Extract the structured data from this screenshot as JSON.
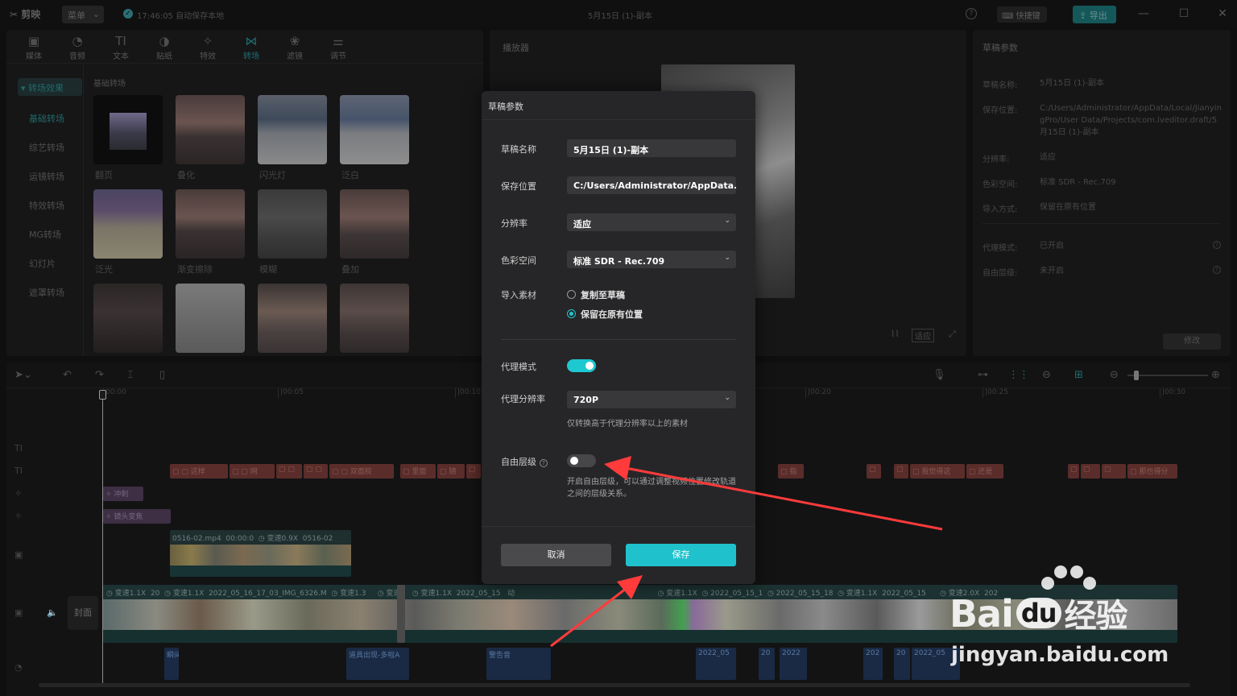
{
  "app": {
    "logo": "剪映",
    "menu_label": "菜单",
    "autosave_text": "17:46:05 自动保存本地",
    "project_title": "5月15日 (1)-副本",
    "shortcut_label": "快捷键",
    "export_label": "导出",
    "accent": "#1ec8d0"
  },
  "media_panel": {
    "tabs": [
      {
        "label": "媒体",
        "icon": "media-icon"
      },
      {
        "label": "音频",
        "icon": "audio-icon"
      },
      {
        "label": "文本",
        "icon": "text-icon"
      },
      {
        "label": "贴纸",
        "icon": "sticker-icon"
      },
      {
        "label": "特效",
        "icon": "effects-icon"
      },
      {
        "label": "转场",
        "icon": "transition-icon"
      },
      {
        "label": "滤镜",
        "icon": "filter-icon"
      },
      {
        "label": "调节",
        "icon": "adjust-icon"
      }
    ],
    "active_tab": "转场",
    "categories": [
      "转场效果",
      "基础转场",
      "综艺转场",
      "运镜转场",
      "特效转场",
      "MG转场",
      "幻灯片",
      "遮罩转场"
    ],
    "section_title": "基础转场",
    "thumbnails": [
      "翻页",
      "叠化",
      "闪光灯",
      "泛白",
      "泛光",
      "渐变擦除",
      "模糊",
      "叠加",
      "",
      "",
      "",
      ""
    ]
  },
  "player": {
    "title": "播放器",
    "ratio_label": "适应"
  },
  "draft_panel": {
    "title": "草稿参数",
    "rows": [
      {
        "key": "草稿名称:",
        "value": "5月15日 (1)-副本"
      },
      {
        "key": "保存位置:",
        "value": "C:/Users/Administrator/AppData/Local/JianyingPro/User Data/Projects/com.lveditor.draft/5月15日 (1)-副本"
      },
      {
        "key": "分辨率:",
        "value": "适应"
      },
      {
        "key": "色彩空间:",
        "value": "标准 SDR - Rec.709"
      },
      {
        "key": "导入方式:",
        "value": "保留在原有位置"
      },
      {
        "key": "代理模式:",
        "value": "已开启"
      },
      {
        "key": "自由层级:",
        "value": "未开启"
      }
    ],
    "edit_label": "修改"
  },
  "timeline": {
    "ruler": [
      "00:00",
      "|00:05",
      "|00:10",
      "|00:20",
      "|00:25",
      "|00:30"
    ],
    "cover_label": "封面",
    "fx_clips": [
      "冲刺",
      "镜头变焦"
    ],
    "text_clips": [
      "这样",
      "网",
      "双面胶",
      "里面",
      "随",
      "指",
      "我觉得这",
      "还是",
      "那也得分"
    ],
    "video_clips": [
      "0516-02.mp4",
      "00:00:0",
      "变速0.9X",
      "0516-02"
    ],
    "main_clips": [
      "变速1.1X",
      "20",
      "变速1.1X",
      "2022_05_16_17_03_IMG_6326.M",
      "变速1.3",
      "变速1",
      "变速1.1X",
      "2022_05_15",
      "动",
      "2022_0",
      "变速1.1X",
      "2022_05_15_1",
      "2022_05_15_18",
      "变速1.1X",
      "2022_05_15",
      "变速2.0X",
      "202"
    ],
    "audio_clips": [
      "瞬间",
      "道具出现-多啦A",
      "警告音",
      "2022_05",
      "20",
      "2022",
      "202",
      "20",
      "2022_05"
    ]
  },
  "dialog": {
    "title": "草稿参数",
    "name_label": "草稿名称",
    "name_value": "5月15日 (1)-副本",
    "path_label": "保存位置",
    "path_value": "C:/Users/Administrator/AppData...",
    "resolution_label": "分辨率",
    "resolution_value": "适应",
    "colorspace_label": "色彩空间",
    "colorspace_value": "标准 SDR - Rec.709",
    "import_label": "导入素材",
    "import_options": [
      "复制至草稿",
      "保留在原有位置"
    ],
    "import_selected": 1,
    "proxy_label": "代理模式",
    "proxy_on": true,
    "proxy_res_label": "代理分辨率",
    "proxy_res_value": "720P",
    "proxy_hint": "仅转换高于代理分辨率以上的素材",
    "layer_label": "自由层级",
    "layer_on": false,
    "layer_hint": "开启自由层级，可以通过调整视频位置修改轨道之间的层级关系。",
    "cancel_label": "取消",
    "save_label": "保存"
  },
  "watermark": {
    "brand": "Bai",
    "brand2": "du",
    "brand3": "经验",
    "url": "jingyan.baidu.com"
  }
}
